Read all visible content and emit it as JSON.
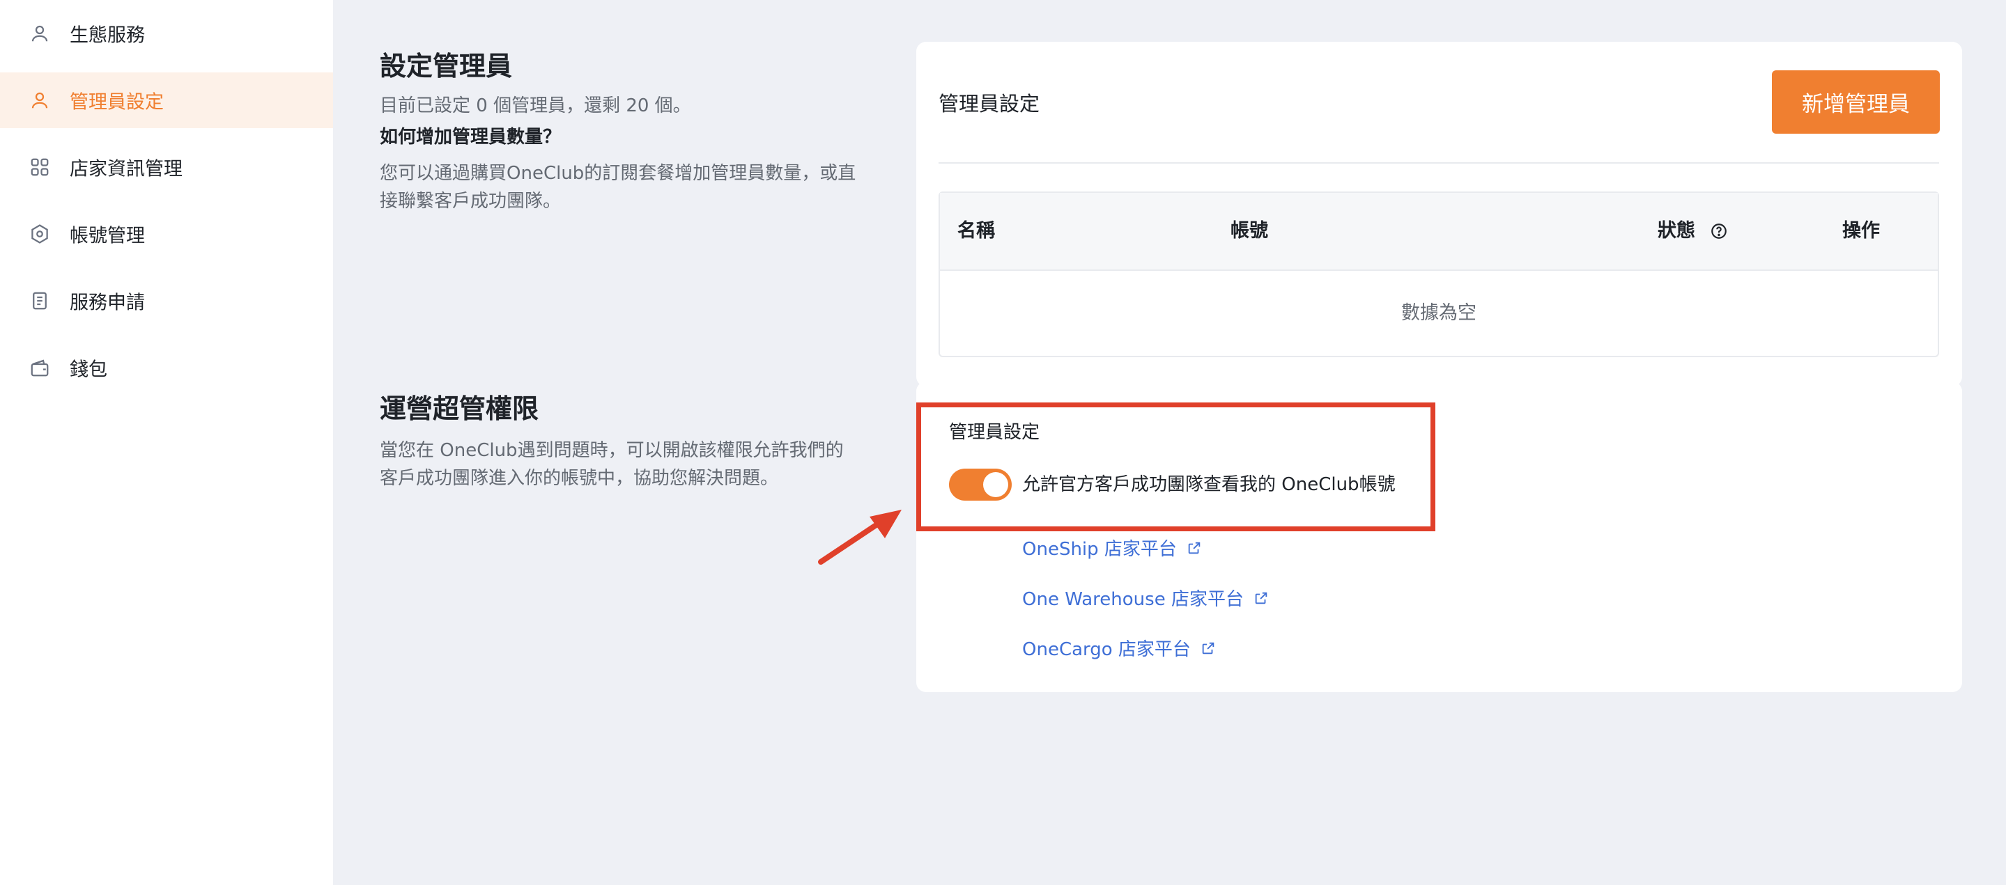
{
  "colors": {
    "accent": "#f07f30",
    "link": "#3f6fd6",
    "annotation": "#e0402a"
  },
  "sidebar": {
    "items": [
      {
        "label": "生態服務",
        "icon": "user-icon",
        "active": false
      },
      {
        "label": "管理員設定",
        "icon": "user-icon",
        "active": true
      },
      {
        "label": "店家資訊管理",
        "icon": "grid-icon",
        "active": false
      },
      {
        "label": "帳號管理",
        "icon": "hexagon-icon",
        "active": false
      },
      {
        "label": "服務申請",
        "icon": "document-icon",
        "active": false
      },
      {
        "label": "錢包",
        "icon": "wallet-icon",
        "active": false
      }
    ]
  },
  "admin_section": {
    "title": "設定管理員",
    "quota_text": "目前已設定 0 個管理員，還剩 20 個。",
    "how_title": "如何增加管理員數量？",
    "how_line1": "您可以通過購買OneClub的訂閱套餐增加管理員數量，或直",
    "how_line2": "接聯繫客戶成功團隊。"
  },
  "admin_card": {
    "title": "管理員設定",
    "add_button": "新增管理員",
    "columns": {
      "name": "名稱",
      "account": "帳號",
      "status": "狀態",
      "action": "操作"
    },
    "empty_text": "數據為空"
  },
  "super_section": {
    "title": "運營超管權限",
    "desc_line1": "當您在 OneClub遇到問題時，可以開啟該權限允許我們的",
    "desc_line2": "客戶成功團隊進入你的帳號中，協助您解決問題。"
  },
  "super_card": {
    "title": "管理員設定",
    "toggle_label": "允許官方客戶成功團隊查看我的 OneClub帳號",
    "toggle_on": true,
    "links": [
      "OneShip 店家平台",
      "One Warehouse 店家平台",
      "OneCargo 店家平台"
    ]
  }
}
